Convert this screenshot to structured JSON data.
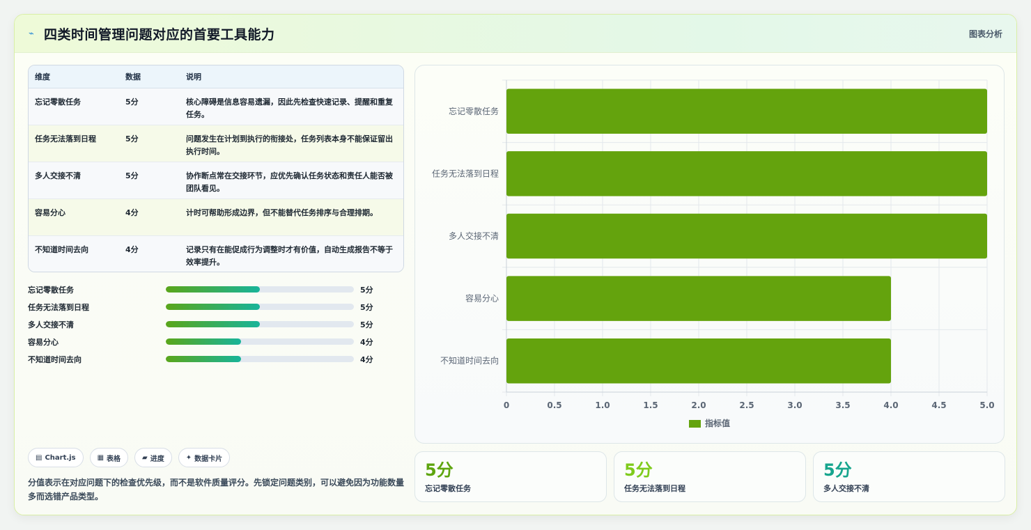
{
  "header": {
    "title": "四类时间管理问题对应的首要工具能力",
    "tag": "图表分析",
    "logo_icon": "chart-line-icon"
  },
  "table": {
    "headers": [
      "维度",
      "数据",
      "说明"
    ],
    "rows": [
      {
        "dim": "忘记零散任务",
        "val": "5分",
        "desc": "核心障碍是信息容易遗漏，因此先检查快速记录、提醒和重复任务。"
      },
      {
        "dim": "任务无法落到日程",
        "val": "5分",
        "desc": "问题发生在计划到执行的衔接处，任务列表本身不能保证留出执行时间。"
      },
      {
        "dim": "多人交接不清",
        "val": "5分",
        "desc": "协作断点常在交接环节，应优先确认任务状态和责任人能否被团队看见。"
      },
      {
        "dim": "容易分心",
        "val": "4分",
        "desc": "计时可帮助形成边界，但不能替代任务排序与合理排期。"
      },
      {
        "dim": "不知道时间去向",
        "val": "4分",
        "desc": "记录只有在能促成行为调整时才有价值，自动生成报告不等于效率提升。"
      }
    ]
  },
  "progress": [
    {
      "label": "忘记零散任务",
      "value": 5,
      "text": "5分"
    },
    {
      "label": "任务无法落到日程",
      "value": 5,
      "text": "5分"
    },
    {
      "label": "多人交接不清",
      "value": 5,
      "text": "5分"
    },
    {
      "label": "容易分心",
      "value": 4,
      "text": "4分"
    },
    {
      "label": "不知道时间去向",
      "value": 4,
      "text": "4分"
    }
  ],
  "progress_max": 10,
  "chips": [
    {
      "icon": "▤",
      "label": "Chart.js"
    },
    {
      "icon": "▦",
      "label": "表格"
    },
    {
      "icon": "▰",
      "label": "进度"
    },
    {
      "icon": "✦",
      "label": "数据卡片"
    }
  ],
  "note": "分值表示在对应问题下的检查优先级，而不是软件质量评分。先锁定问题类别，可以避免因为功能数量多而选错产品类型。",
  "chart_data": {
    "type": "bar",
    "orientation": "horizontal",
    "categories": [
      "忘记零散任务",
      "任务无法落到日程",
      "多人交接不清",
      "容易分心",
      "不知道时间去向"
    ],
    "series": [
      {
        "name": "指标值",
        "values": [
          5,
          5,
          5,
          4,
          4
        ]
      }
    ],
    "xlim": [
      0,
      5
    ],
    "x_ticks": [
      "0",
      "0.5",
      "1.0",
      "1.5",
      "2.0",
      "2.5",
      "3.0",
      "3.5",
      "4.0",
      "4.5",
      "5.0"
    ],
    "grid": true,
    "legend": "bottom",
    "bar_color": "#64a30d"
  },
  "stats": [
    {
      "num": "5分",
      "cap": "忘记零散任务",
      "color": "#5ea50f"
    },
    {
      "num": "5分",
      "cap": "任务无法落到日程",
      "color": "#7fcb1c"
    },
    {
      "num": "5分",
      "cap": "多人交接不清",
      "color": "#17a58e"
    }
  ]
}
